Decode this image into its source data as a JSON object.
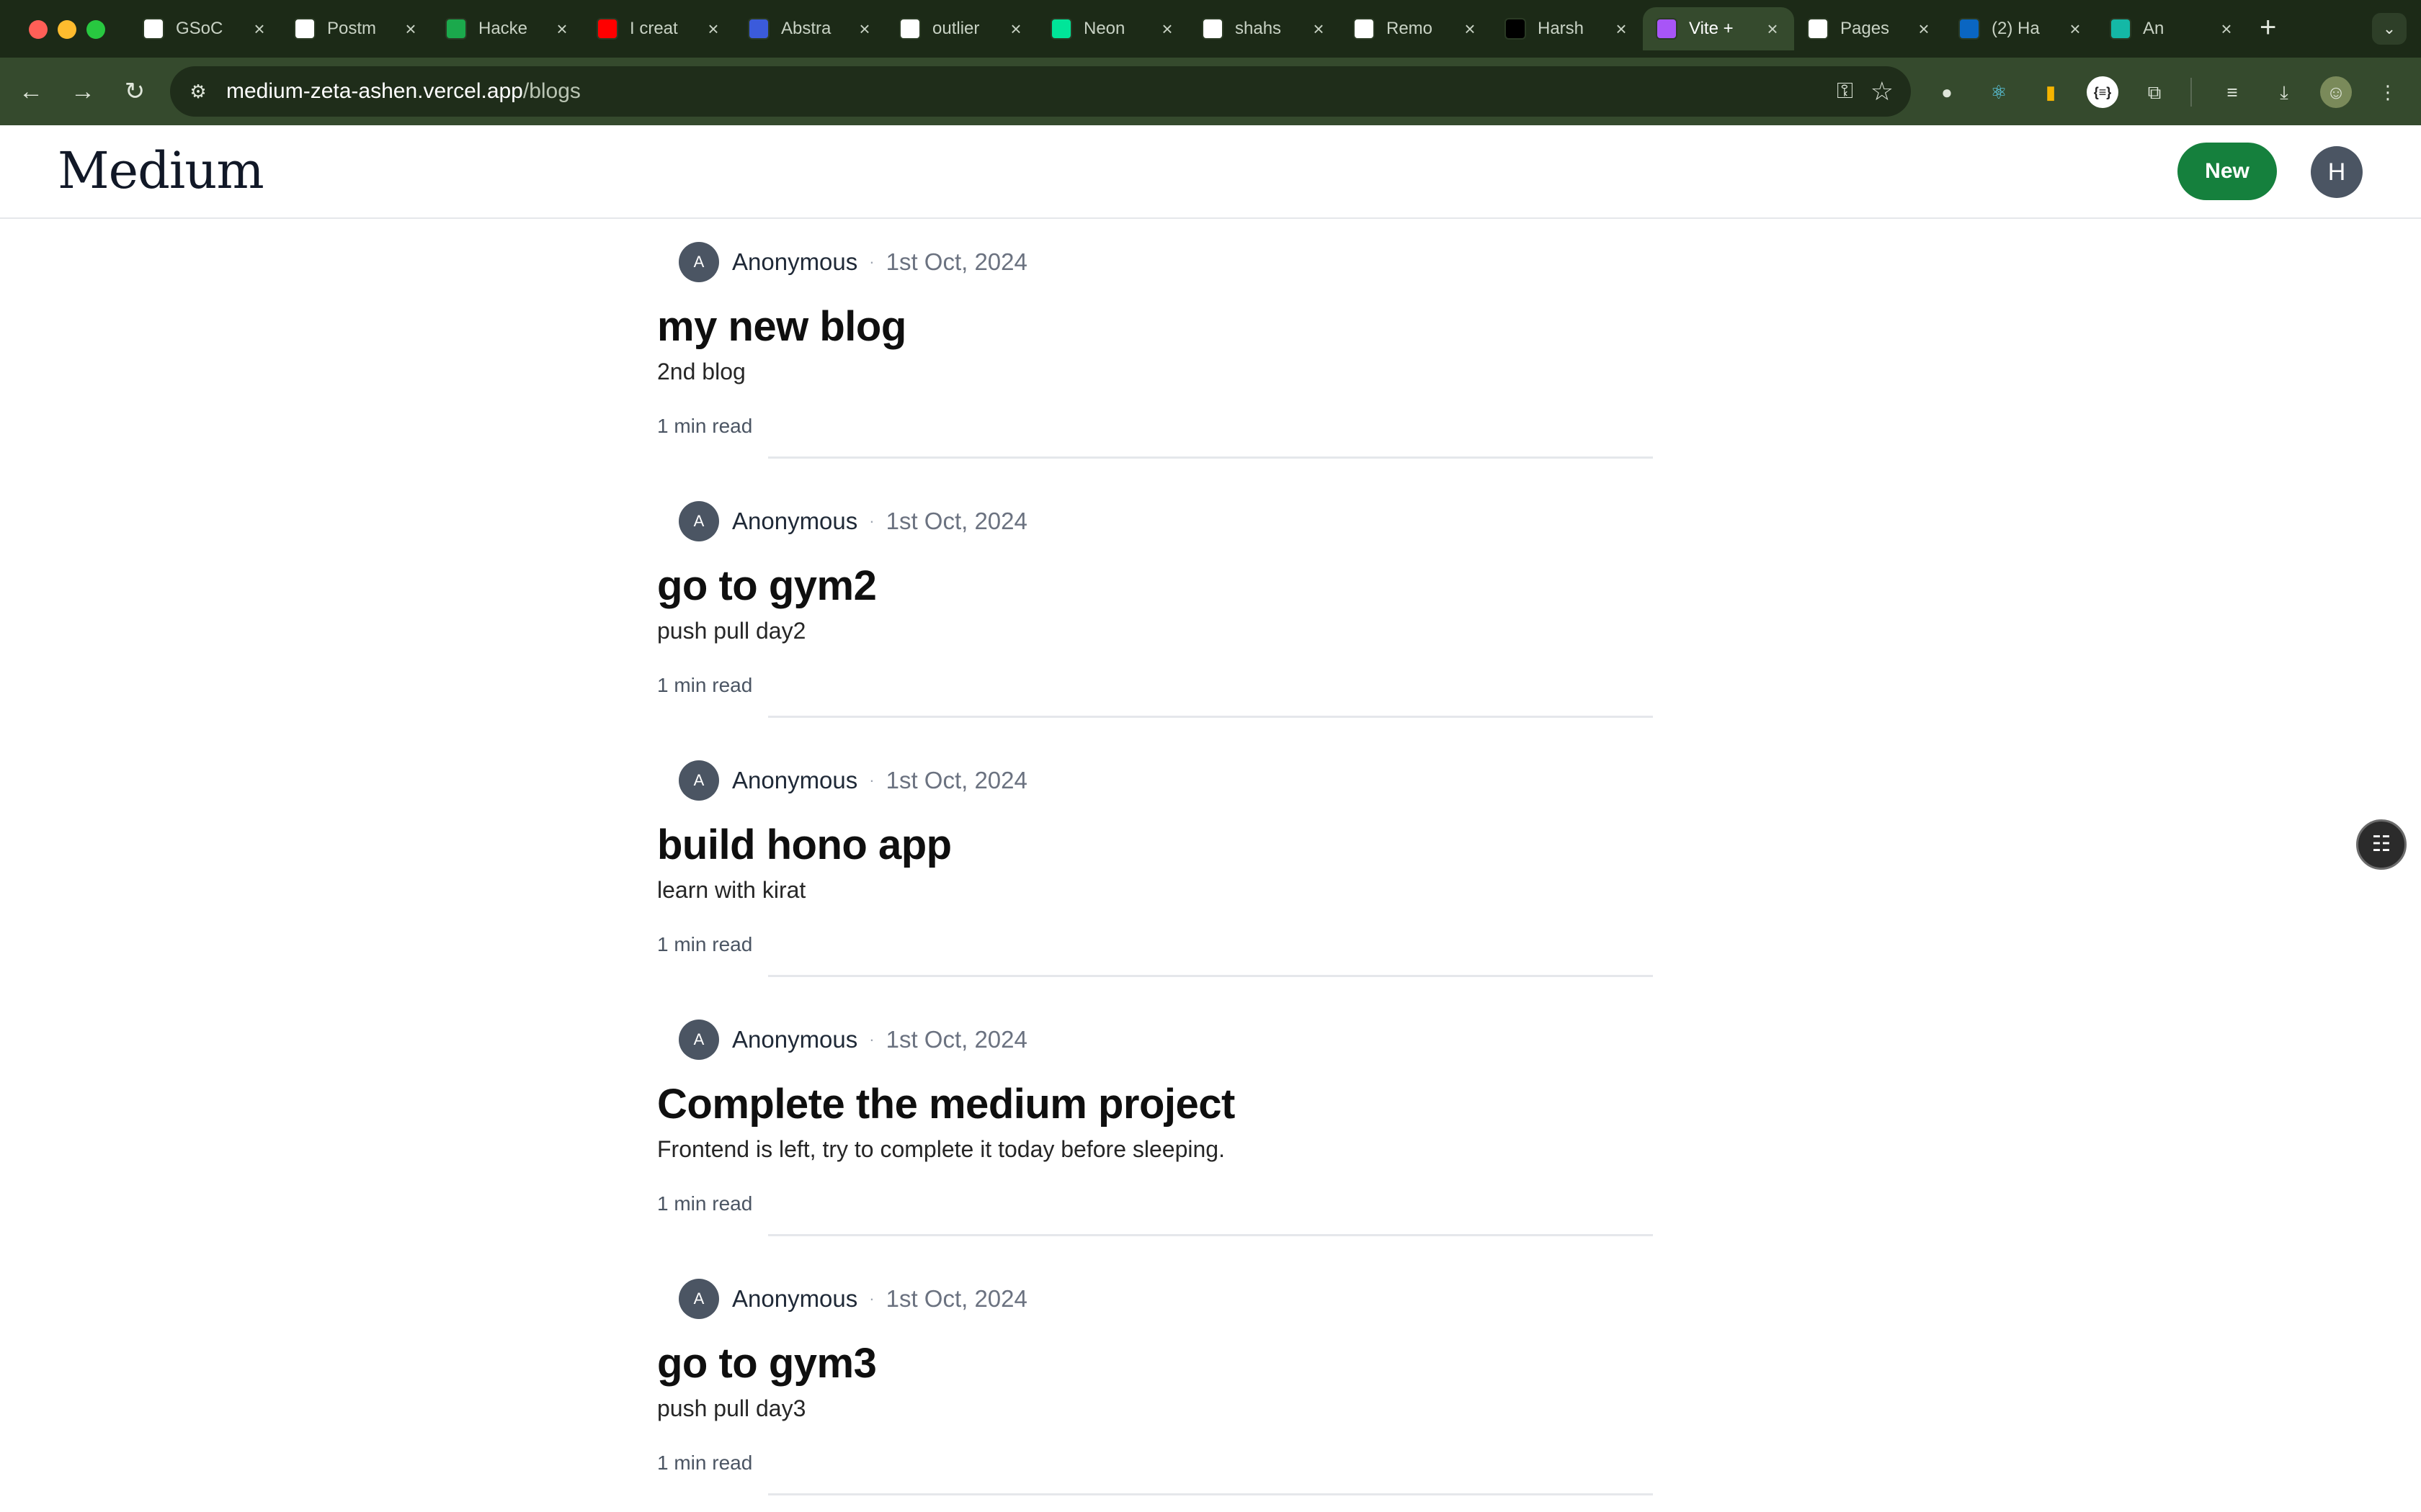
{
  "browser": {
    "tabs": [
      {
        "title": "GSoC",
        "icon": "notion-icon",
        "color": "#ffffff",
        "active": false
      },
      {
        "title": "Postm",
        "icon": "google-icon",
        "color": "#ffffff",
        "active": false
      },
      {
        "title": "Hacke",
        "icon": "hackerrank-icon",
        "color": "#1ba94c",
        "active": false
      },
      {
        "title": "I creat",
        "icon": "youtube-icon",
        "color": "#ff0000",
        "active": false
      },
      {
        "title": "Abstra",
        "icon": "abstract-icon",
        "color": "#3b5bdb",
        "active": false
      },
      {
        "title": "outlier",
        "icon": "google-icon",
        "color": "#ffffff",
        "active": false
      },
      {
        "title": "Neon",
        "icon": "neon-icon",
        "color": "#00e599",
        "active": false
      },
      {
        "title": "shahs",
        "icon": "github-icon",
        "color": "#ffffff",
        "active": false
      },
      {
        "title": "Remo",
        "icon": "openai-icon",
        "color": "#ffffff",
        "active": false
      },
      {
        "title": "Harsh",
        "icon": "ss-icon",
        "color": "#000000",
        "active": false
      },
      {
        "title": "Vite +",
        "icon": "vite-icon",
        "color": "#a855f7",
        "active": true
      },
      {
        "title": "Pages",
        "icon": "github-icon",
        "color": "#ffffff",
        "active": false
      },
      {
        "title": "(2) Ha",
        "icon": "linkedin-icon",
        "color": "#0a66c2",
        "active": false
      },
      {
        "title": "An",
        "icon": "app-icon",
        "color": "#14b8a6",
        "active": false
      }
    ],
    "url_host": "medium-zeta-ashen.vercel.app",
    "url_path": "/blogs"
  },
  "app": {
    "logo": "Medium",
    "new_button": "New",
    "user_initial": "H"
  },
  "posts": [
    {
      "author_initial": "A",
      "author": "Anonymous",
      "separator": "·",
      "date": "1st Oct, 2024",
      "title": "my new blog",
      "excerpt": "2nd blog",
      "read_time": "1 min read"
    },
    {
      "author_initial": "A",
      "author": "Anonymous",
      "separator": "·",
      "date": "1st Oct, 2024",
      "title": "go to gym2",
      "excerpt": "push pull day2",
      "read_time": "1 min read"
    },
    {
      "author_initial": "A",
      "author": "Anonymous",
      "separator": "·",
      "date": "1st Oct, 2024",
      "title": "build hono app",
      "excerpt": "learn with kirat",
      "read_time": "1 min read"
    },
    {
      "author_initial": "A",
      "author": "Anonymous",
      "separator": "·",
      "date": "1st Oct, 2024",
      "title": "Complete the medium project",
      "excerpt": "Frontend is left, try to complete it today before sleeping.",
      "read_time": "1 min read"
    },
    {
      "author_initial": "A",
      "author": "Anonymous",
      "separator": "·",
      "date": "1st Oct, 2024",
      "title": "go to gym3",
      "excerpt": "push pull day3",
      "read_time": "1 min read"
    }
  ]
}
